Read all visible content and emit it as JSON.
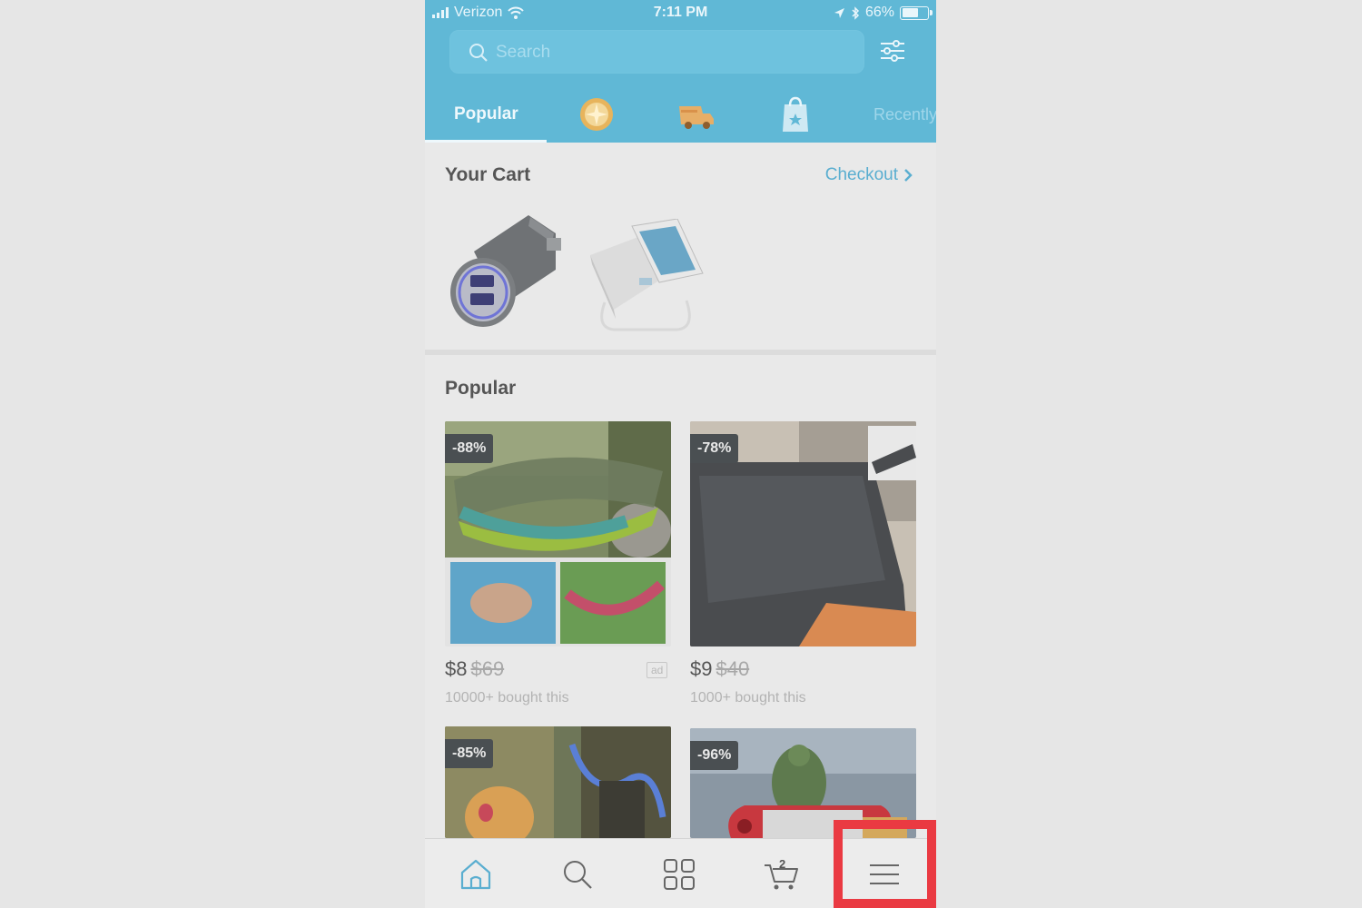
{
  "status_bar": {
    "carrier": "Verizon",
    "time": "7:11 PM",
    "battery": "66%",
    "battery_level": 0.66
  },
  "search": {
    "placeholder": "Search"
  },
  "tabs": {
    "popular": "Popular",
    "icons": [
      "coin-icon",
      "delivery-truck-icon",
      "shopping-bag-star-icon"
    ],
    "recently": "Recently"
  },
  "cart": {
    "title": "Your Cart",
    "checkout_label": "Checkout",
    "items": [
      "car-charger-image",
      "power-bank-image"
    ]
  },
  "popular": {
    "title": "Popular",
    "products": [
      {
        "discount": "-88%",
        "price": "$8",
        "old_price": "$69",
        "bought": "10000+ bought this",
        "ad": "ad"
      },
      {
        "discount": "-78%",
        "price": "$9",
        "old_price": "$40",
        "bought": "1000+ bought this"
      },
      {
        "discount": "-85%"
      },
      {
        "discount": "-96%"
      }
    ]
  },
  "bottom_nav": {
    "items": [
      "home-icon",
      "search-icon",
      "grid-icon",
      "cart-icon",
      "menu-icon"
    ],
    "cart_count": "2"
  },
  "colors": {
    "header": "#60b8d6",
    "accent": "#5aaed0",
    "highlight": "#ea3a42"
  }
}
